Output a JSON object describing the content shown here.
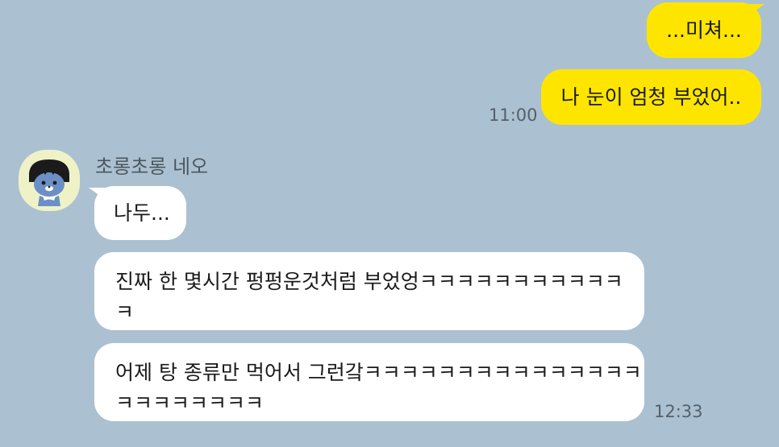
{
  "chat": {
    "outgoing": [
      {
        "text": "...미쳐..."
      },
      {
        "text": "나 눈이 엄청 부었어..",
        "time": "11:00"
      }
    ],
    "sender": {
      "name": "초롱초롱 네오",
      "avatar_icon": "neo-character-avatar-icon"
    },
    "incoming": [
      {
        "lines": [
          "나두..."
        ]
      },
      {
        "lines": [
          "진짜 한 몇시간 펑펑운것처럼 부었엉ㅋㅋㅋㅋㅋㅋㅋㅋㅋㅋㅋ",
          "ㅋ"
        ]
      },
      {
        "lines": [
          "어제 탕 종류만 먹어서 그런갘ㅋㅋㅋㅋㅋㅋㅋㅋㅋㅋㅋㅋㅋㅋㅋ",
          "ㅋㅋㅋㅋㅋㅋㅋㅋ"
        ],
        "time": "12:33"
      }
    ]
  },
  "colors": {
    "background": "#abc1d1",
    "outgoing_bubble": "#fee500",
    "incoming_bubble": "#ffffff",
    "avatar_background": "#eef2c6"
  }
}
